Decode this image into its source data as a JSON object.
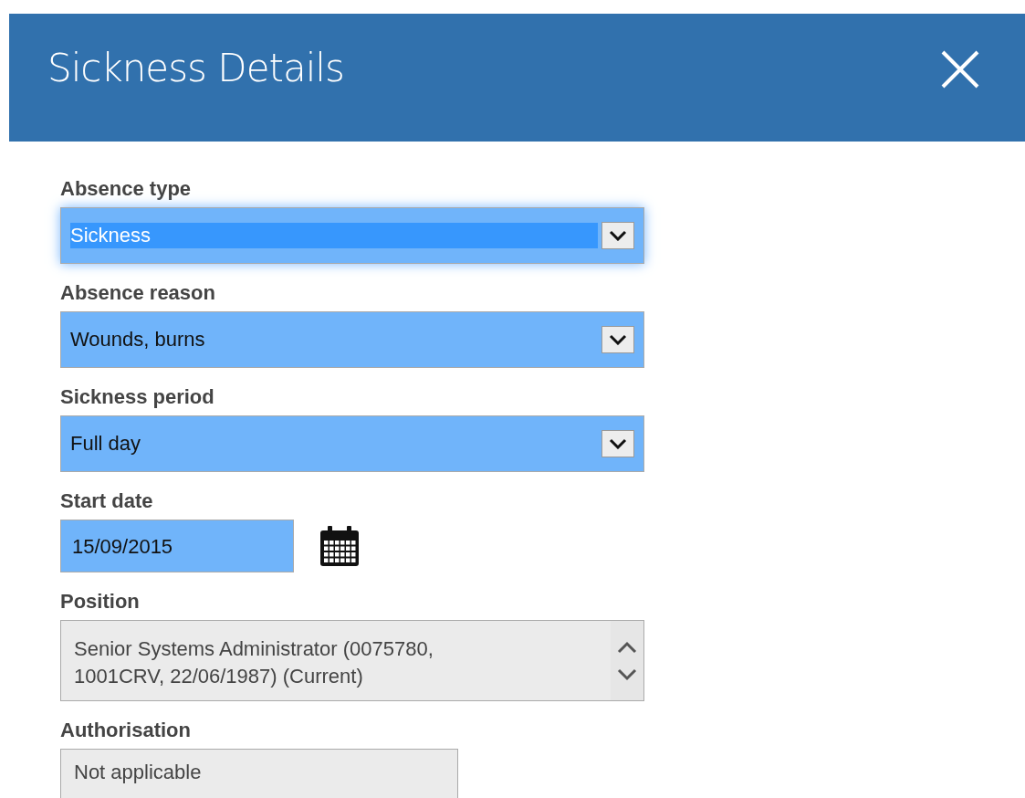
{
  "dialog": {
    "title": "Sickness Details"
  },
  "fields": [
    {
      "kind": "select",
      "label": "Absence type",
      "value": "Sickness",
      "focused": true,
      "disabled": false
    },
    {
      "kind": "select",
      "label": "Absence reason",
      "value": "Wounds, burns",
      "focused": false,
      "disabled": false
    },
    {
      "kind": "select",
      "label": "Sickness period",
      "value": "Full day",
      "focused": false,
      "disabled": false
    },
    {
      "kind": "date",
      "label": "Start date",
      "value": "15/09/2015",
      "focused": false,
      "disabled": false
    },
    {
      "kind": "listbox",
      "label": "Position",
      "value": "Senior Systems Administrator (0075780, 1001CRV, 22/06/1987) (Current)",
      "focused": false,
      "disabled": true
    },
    {
      "kind": "text",
      "label": "Authorisation",
      "value": "Not applicable",
      "focused": false,
      "disabled": true
    }
  ]
}
